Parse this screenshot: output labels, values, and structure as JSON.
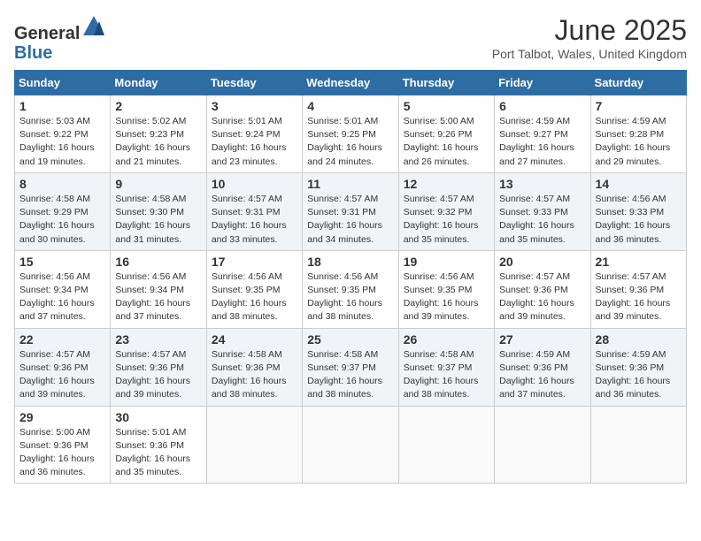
{
  "header": {
    "logo_general": "General",
    "logo_blue": "Blue",
    "month_title": "June 2025",
    "location": "Port Talbot, Wales, United Kingdom"
  },
  "weekdays": [
    "Sunday",
    "Monday",
    "Tuesday",
    "Wednesday",
    "Thursday",
    "Friday",
    "Saturday"
  ],
  "weeks": [
    [
      {
        "day": "1",
        "sunrise": "Sunrise: 5:03 AM",
        "sunset": "Sunset: 9:22 PM",
        "daylight": "Daylight: 16 hours and 19 minutes."
      },
      {
        "day": "2",
        "sunrise": "Sunrise: 5:02 AM",
        "sunset": "Sunset: 9:23 PM",
        "daylight": "Daylight: 16 hours and 21 minutes."
      },
      {
        "day": "3",
        "sunrise": "Sunrise: 5:01 AM",
        "sunset": "Sunset: 9:24 PM",
        "daylight": "Daylight: 16 hours and 23 minutes."
      },
      {
        "day": "4",
        "sunrise": "Sunrise: 5:01 AM",
        "sunset": "Sunset: 9:25 PM",
        "daylight": "Daylight: 16 hours and 24 minutes."
      },
      {
        "day": "5",
        "sunrise": "Sunrise: 5:00 AM",
        "sunset": "Sunset: 9:26 PM",
        "daylight": "Daylight: 16 hours and 26 minutes."
      },
      {
        "day": "6",
        "sunrise": "Sunrise: 4:59 AM",
        "sunset": "Sunset: 9:27 PM",
        "daylight": "Daylight: 16 hours and 27 minutes."
      },
      {
        "day": "7",
        "sunrise": "Sunrise: 4:59 AM",
        "sunset": "Sunset: 9:28 PM",
        "daylight": "Daylight: 16 hours and 29 minutes."
      }
    ],
    [
      {
        "day": "8",
        "sunrise": "Sunrise: 4:58 AM",
        "sunset": "Sunset: 9:29 PM",
        "daylight": "Daylight: 16 hours and 30 minutes."
      },
      {
        "day": "9",
        "sunrise": "Sunrise: 4:58 AM",
        "sunset": "Sunset: 9:30 PM",
        "daylight": "Daylight: 16 hours and 31 minutes."
      },
      {
        "day": "10",
        "sunrise": "Sunrise: 4:57 AM",
        "sunset": "Sunset: 9:31 PM",
        "daylight": "Daylight: 16 hours and 33 minutes."
      },
      {
        "day": "11",
        "sunrise": "Sunrise: 4:57 AM",
        "sunset": "Sunset: 9:31 PM",
        "daylight": "Daylight: 16 hours and 34 minutes."
      },
      {
        "day": "12",
        "sunrise": "Sunrise: 4:57 AM",
        "sunset": "Sunset: 9:32 PM",
        "daylight": "Daylight: 16 hours and 35 minutes."
      },
      {
        "day": "13",
        "sunrise": "Sunrise: 4:57 AM",
        "sunset": "Sunset: 9:33 PM",
        "daylight": "Daylight: 16 hours and 35 minutes."
      },
      {
        "day": "14",
        "sunrise": "Sunrise: 4:56 AM",
        "sunset": "Sunset: 9:33 PM",
        "daylight": "Daylight: 16 hours and 36 minutes."
      }
    ],
    [
      {
        "day": "15",
        "sunrise": "Sunrise: 4:56 AM",
        "sunset": "Sunset: 9:34 PM",
        "daylight": "Daylight: 16 hours and 37 minutes."
      },
      {
        "day": "16",
        "sunrise": "Sunrise: 4:56 AM",
        "sunset": "Sunset: 9:34 PM",
        "daylight": "Daylight: 16 hours and 37 minutes."
      },
      {
        "day": "17",
        "sunrise": "Sunrise: 4:56 AM",
        "sunset": "Sunset: 9:35 PM",
        "daylight": "Daylight: 16 hours and 38 minutes."
      },
      {
        "day": "18",
        "sunrise": "Sunrise: 4:56 AM",
        "sunset": "Sunset: 9:35 PM",
        "daylight": "Daylight: 16 hours and 38 minutes."
      },
      {
        "day": "19",
        "sunrise": "Sunrise: 4:56 AM",
        "sunset": "Sunset: 9:35 PM",
        "daylight": "Daylight: 16 hours and 39 minutes."
      },
      {
        "day": "20",
        "sunrise": "Sunrise: 4:57 AM",
        "sunset": "Sunset: 9:36 PM",
        "daylight": "Daylight: 16 hours and 39 minutes."
      },
      {
        "day": "21",
        "sunrise": "Sunrise: 4:57 AM",
        "sunset": "Sunset: 9:36 PM",
        "daylight": "Daylight: 16 hours and 39 minutes."
      }
    ],
    [
      {
        "day": "22",
        "sunrise": "Sunrise: 4:57 AM",
        "sunset": "Sunset: 9:36 PM",
        "daylight": "Daylight: 16 hours and 39 minutes."
      },
      {
        "day": "23",
        "sunrise": "Sunrise: 4:57 AM",
        "sunset": "Sunset: 9:36 PM",
        "daylight": "Daylight: 16 hours and 39 minutes."
      },
      {
        "day": "24",
        "sunrise": "Sunrise: 4:58 AM",
        "sunset": "Sunset: 9:36 PM",
        "daylight": "Daylight: 16 hours and 38 minutes."
      },
      {
        "day": "25",
        "sunrise": "Sunrise: 4:58 AM",
        "sunset": "Sunset: 9:37 PM",
        "daylight": "Daylight: 16 hours and 38 minutes."
      },
      {
        "day": "26",
        "sunrise": "Sunrise: 4:58 AM",
        "sunset": "Sunset: 9:37 PM",
        "daylight": "Daylight: 16 hours and 38 minutes."
      },
      {
        "day": "27",
        "sunrise": "Sunrise: 4:59 AM",
        "sunset": "Sunset: 9:36 PM",
        "daylight": "Daylight: 16 hours and 37 minutes."
      },
      {
        "day": "28",
        "sunrise": "Sunrise: 4:59 AM",
        "sunset": "Sunset: 9:36 PM",
        "daylight": "Daylight: 16 hours and 36 minutes."
      }
    ],
    [
      {
        "day": "29",
        "sunrise": "Sunrise: 5:00 AM",
        "sunset": "Sunset: 9:36 PM",
        "daylight": "Daylight: 16 hours and 36 minutes."
      },
      {
        "day": "30",
        "sunrise": "Sunrise: 5:01 AM",
        "sunset": "Sunset: 9:36 PM",
        "daylight": "Daylight: 16 hours and 35 minutes."
      },
      null,
      null,
      null,
      null,
      null
    ]
  ]
}
